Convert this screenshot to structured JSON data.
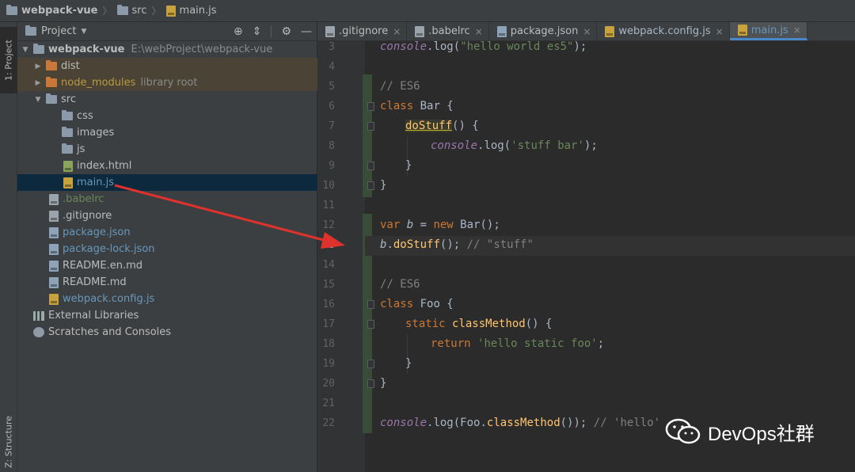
{
  "breadcrumb": {
    "project": "webpack-vue",
    "folder": "src",
    "file": "main.js"
  },
  "left_strip": {
    "project_tab": "1: Project",
    "structure_tab": "Z: Structure"
  },
  "project_panel": {
    "title": "Project",
    "tree": [
      {
        "label": "webpack-vue",
        "extra": "E:\\webProject\\webpack-vue"
      },
      {
        "label": "dist"
      },
      {
        "label": "node_modules",
        "extra": "library root"
      },
      {
        "label": "src"
      },
      {
        "label": "css"
      },
      {
        "label": "images"
      },
      {
        "label": "js"
      },
      {
        "label": "index.html"
      },
      {
        "label": "main.js"
      },
      {
        "label": ".babelrc"
      },
      {
        "label": ".gitignore"
      },
      {
        "label": "package.json"
      },
      {
        "label": "package-lock.json"
      },
      {
        "label": "README.en.md"
      },
      {
        "label": "README.md"
      },
      {
        "label": "webpack.config.js"
      },
      {
        "label": "External Libraries"
      },
      {
        "label": "Scratches and Consoles"
      }
    ]
  },
  "editor_tabs": [
    {
      "label": ".gitignore"
    },
    {
      "label": ".babelrc"
    },
    {
      "label": "package.json"
    },
    {
      "label": "webpack.config.js"
    },
    {
      "label": "main.js",
      "active": true
    }
  ],
  "editor": {
    "current_line": 13,
    "lines": [
      {
        "n": "3"
      },
      {
        "n": "4"
      },
      {
        "n": "5"
      },
      {
        "n": "6"
      },
      {
        "n": "7"
      },
      {
        "n": "8"
      },
      {
        "n": "9"
      },
      {
        "n": "10"
      },
      {
        "n": "11"
      },
      {
        "n": "12"
      },
      {
        "n": "13"
      },
      {
        "n": "14"
      },
      {
        "n": "15"
      },
      {
        "n": "16"
      },
      {
        "n": "17"
      },
      {
        "n": "18"
      },
      {
        "n": "19"
      },
      {
        "n": "20"
      },
      {
        "n": "21"
      },
      {
        "n": "22"
      }
    ],
    "code": {
      "l3_obj": "console",
      "l3_rest_a": ".",
      "l3_fn": "log",
      "l3_paren_open": "(",
      "l3_str": "\"hello world es5\"",
      "l3_end": ");",
      "l5": "// ES6",
      "l6_kw": "class",
      "l6_rest": " Bar {",
      "l7_fn": "doStuff",
      "l7_rest": "() {",
      "l8_obj": "console",
      "l8_dot": ".",
      "l8_fn": "log",
      "l8_open": "(",
      "l8_str": "'stuff bar'",
      "l8_end": ");",
      "l9": "}",
      "l10": "}",
      "l12_kw1": "var",
      "l12_var": " b",
      "l12_eq": " = ",
      "l12_kw2": "new",
      "l12_rest": " Bar();",
      "l13_var": "b",
      "l13_dot": ".",
      "l13_fn": "doStuff",
      "l13_rest": "(); ",
      "l13_cmt": "// \"stuff\"",
      "l15": "// ES6",
      "l16_kw": "class",
      "l16_rest": " Foo {",
      "l17_kw": "static",
      "l17_sp": " ",
      "l17_fn": "classMethod",
      "l17_rest": "() {",
      "l18_kw": "return",
      "l18_sp": " ",
      "l18_str": "'hello static foo'",
      "l18_end": ";",
      "l19": "}",
      "l20": "}",
      "l22_obj": "console",
      "l22_dot": ".",
      "l22_fn": "log",
      "l22_mid": "(Foo.",
      "l22_fn2": "classMethod",
      "l22_end": "()); ",
      "l22_cmt": "// 'hello'"
    }
  },
  "watermark": {
    "text": "DevOps社群"
  },
  "colors": {
    "background": "#2b2b2b",
    "panel": "#3c3f41",
    "keyword": "#cc7832",
    "function": "#ffc66d",
    "string": "#6a8759",
    "comment": "#808080",
    "arrow": "#e0322c"
  }
}
